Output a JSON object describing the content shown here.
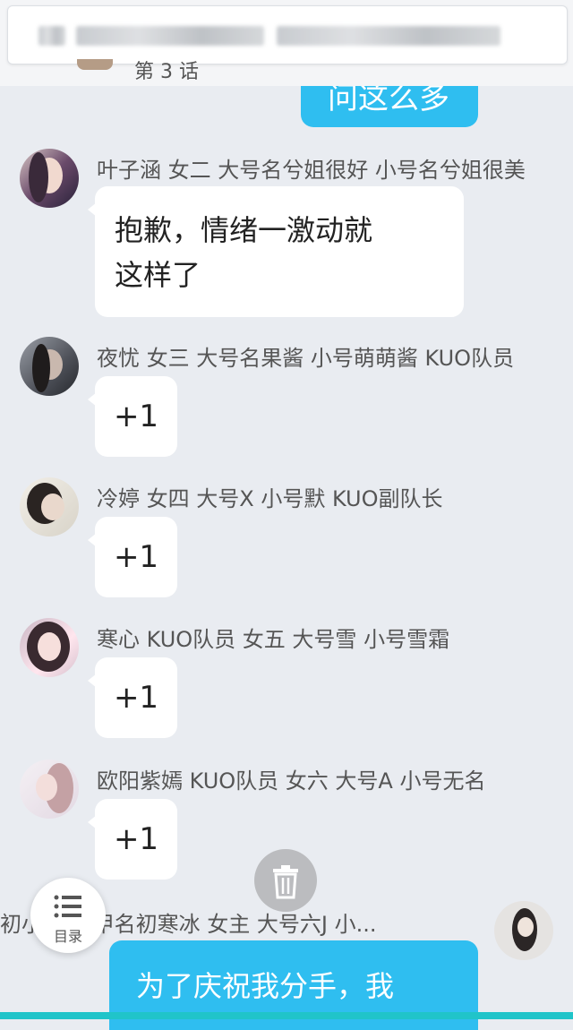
{
  "header": {
    "prev_title": "第 3 话",
    "prev_message": "问这么多"
  },
  "messages": [
    {
      "name": "叶子涵  女二    大号名兮姐很好   小号名兮姐很美",
      "text": "抱歉，情绪一激动就\n这样了"
    },
    {
      "name": "夜忧   女三    大号名果酱   小号萌萌酱   KUO队员",
      "text": "+1"
    },
    {
      "name": "冷婷  女四     大号X   小号默   KUO副队长",
      "text": "+1"
    },
    {
      "name": "寒心    KUO队员   女五   大号雪   小号雪霜",
      "text": "+1"
    },
    {
      "name": "欧阳紫嫣   KUO队员    女六    大号A   小号无名",
      "text": "+1"
    }
  ],
  "bottom": {
    "name": "初小小  马甲名初寒冰   女主   大号六J   小...",
    "message": "为了庆祝我分手，我"
  },
  "menu_label": "目录",
  "colors": {
    "accent": "#2fbef0",
    "background": "#e9ecf1",
    "strip": "#20c4c9"
  },
  "icons": [
    "trash-icon",
    "menu-list-icon"
  ]
}
